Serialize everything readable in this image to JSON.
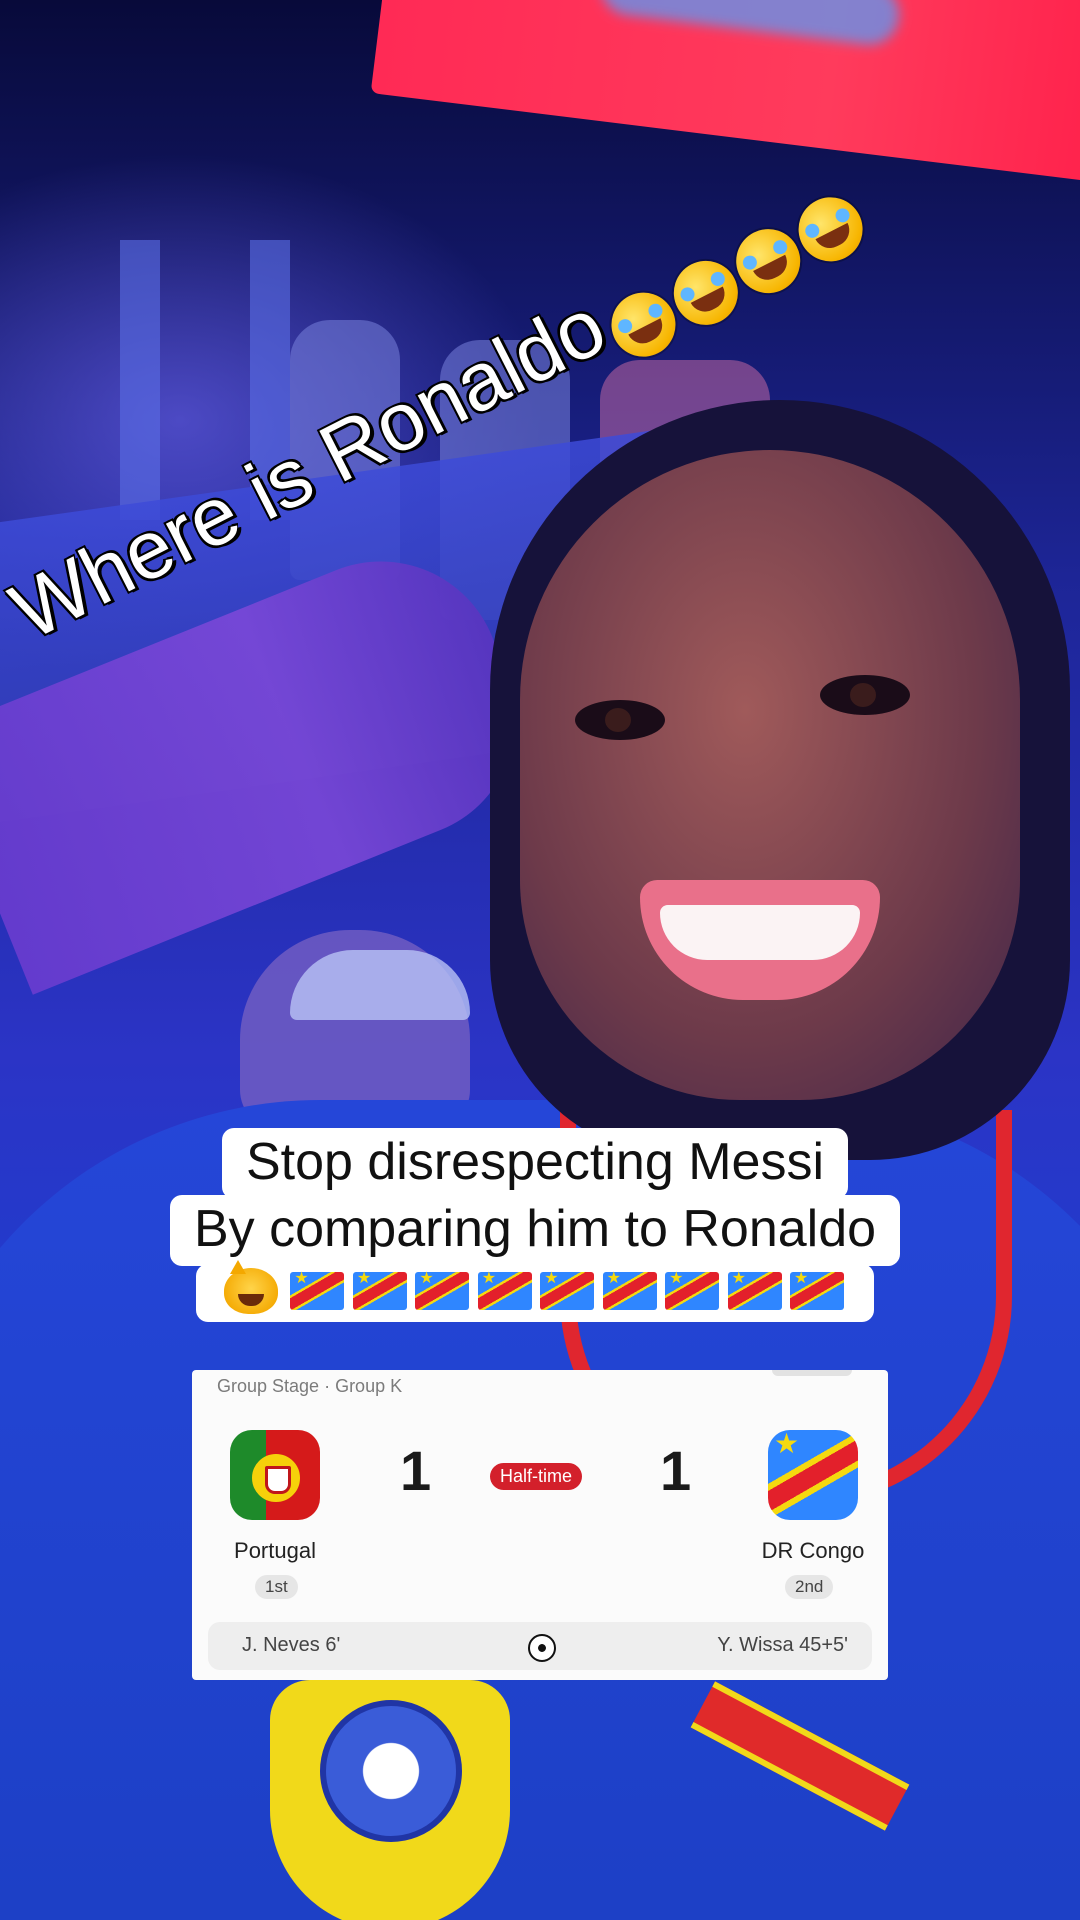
{
  "overlay": {
    "rotated_text": "Where is Ronaldo",
    "rotated_emoji": "rolling-on-floor-laughing",
    "rotated_emoji_count": 4
  },
  "caption": {
    "line1": "Stop disrespecting Messi",
    "line2": "By comparing him to Ronaldo",
    "emoji_line": [
      "cat-tears-of-joy",
      "flag-dr-congo",
      "flag-dr-congo",
      "flag-dr-congo",
      "flag-dr-congo",
      "flag-dr-congo",
      "flag-dr-congo",
      "flag-dr-congo",
      "flag-dr-congo",
      "flag-dr-congo"
    ]
  },
  "scorecard": {
    "stage": "Group Stage · Group K",
    "status": "Half-time",
    "home": {
      "name": "Portugal",
      "rank": "1st",
      "score": "1",
      "scorer": "J. Neves 6'"
    },
    "away": {
      "name": "DR Congo",
      "rank": "2nd",
      "score": "1",
      "scorer": "Y. Wissa 45+5'"
    },
    "event_icon": "soccer-ball-icon"
  },
  "colors": {
    "status_red": "#d3202b",
    "shirt_blue": "#1c3fc4",
    "banner_red": "#ff2a55"
  }
}
